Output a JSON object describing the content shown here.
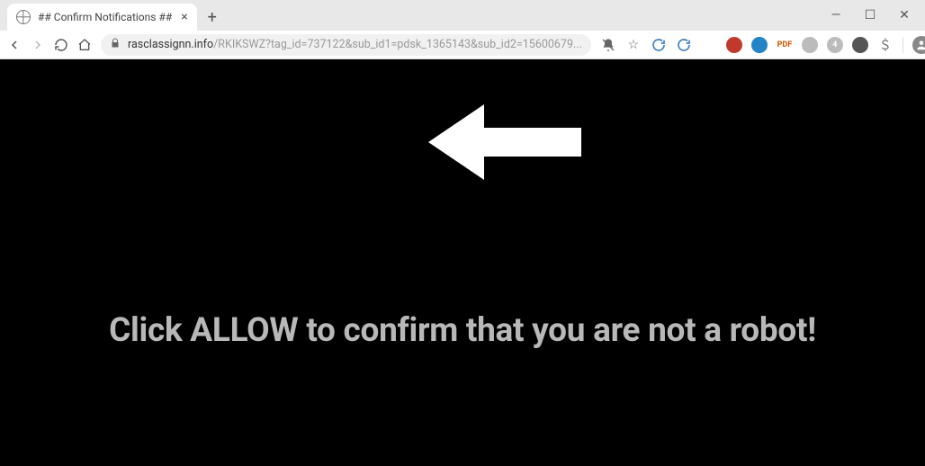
{
  "tab": {
    "title": "## Confirm Notifications ##"
  },
  "url": {
    "domain": "rasclassignn.info",
    "path": "/RKIKSWZ?tag_id=737122&sub_id1=pdsk_1365143&sub_id2=15600679..."
  },
  "extensions": {
    "pdf_label": "PDF",
    "count_badge": "4"
  },
  "page": {
    "message": "Click ALLOW to confirm that you are not a robot!"
  },
  "icons": {
    "close": "×",
    "plus": "+",
    "minimize": "—",
    "maximize": "☐",
    "win_close": "✕",
    "star": "☆",
    "bell_mute": "🔕",
    "money": "＄"
  }
}
